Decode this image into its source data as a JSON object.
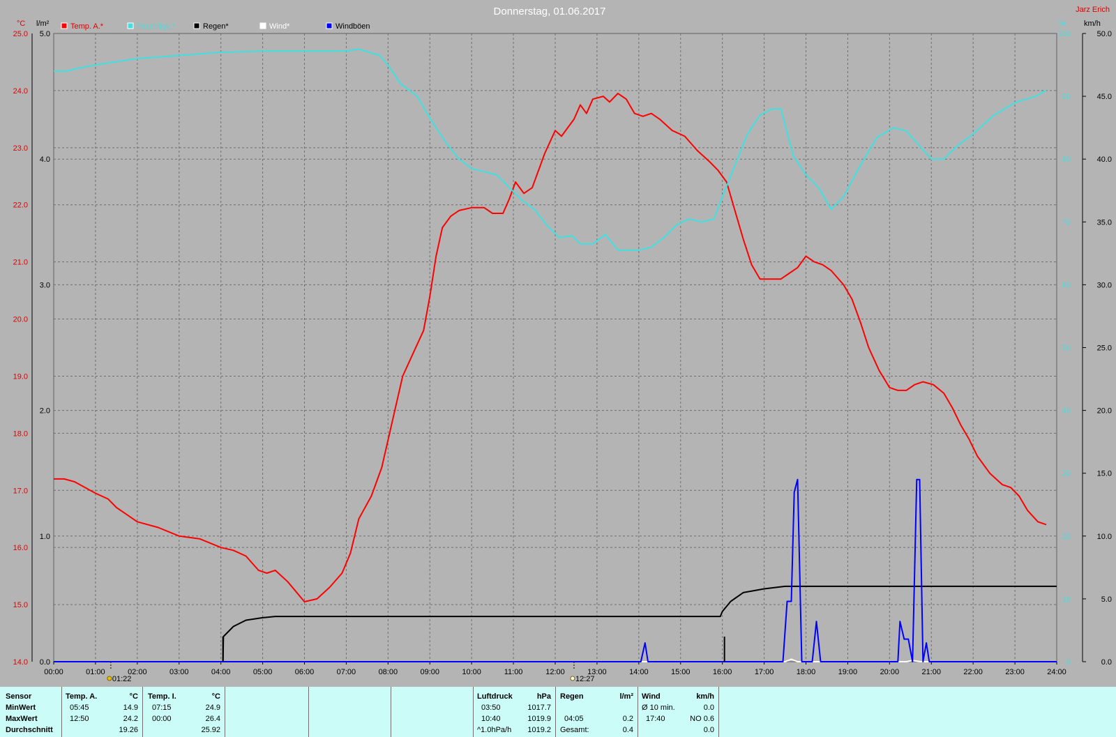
{
  "title": "Donnerstag, 01.06.2017",
  "station": "Jarz Erich",
  "axes": {
    "left_unit": "°C",
    "left_ticks": [
      "25.0",
      "24.0",
      "23.0",
      "22.0",
      "21.0",
      "20.0",
      "19.0",
      "18.0",
      "17.0",
      "16.0",
      "15.0",
      "14.0"
    ],
    "rain_unit": "l/m²",
    "rain_ticks": [
      "5.0",
      "4.0",
      "3.0",
      "2.0",
      "1.0",
      "0.0"
    ],
    "humidity_unit": "%",
    "humidity_ticks": [
      "100",
      "90",
      "80",
      "70",
      "60",
      "50",
      "40",
      "30",
      "20",
      "10",
      "0"
    ],
    "wind_unit": "km/h",
    "wind_ticks": [
      "50.0",
      "45.0",
      "40.0",
      "35.0",
      "30.0",
      "25.0",
      "20.0",
      "15.0",
      "10.0",
      "5.0",
      "0.0"
    ],
    "x_ticks": [
      "00:00",
      "01:00",
      "02:00",
      "03:00",
      "04:00",
      "05:00",
      "06:00",
      "07:00",
      "08:00",
      "09:00",
      "10:00",
      "11:00",
      "12:00",
      "13:00",
      "14:00",
      "15:00",
      "16:00",
      "17:00",
      "18:00",
      "19:00",
      "20:00",
      "21:00",
      "22:00",
      "23:00",
      "24:00"
    ]
  },
  "sun": {
    "sunrise": "01:22",
    "sunset": "12:27"
  },
  "legend": [
    {
      "label": "Temp. A.*",
      "color": "#ff0000"
    },
    {
      "label": "Feuchtigk.*",
      "color": "#40e0e0"
    },
    {
      "label": "Regen*",
      "color": "#000000"
    },
    {
      "label": "Wind*",
      "color": "#ffffff"
    },
    {
      "label": "Windböen",
      "color": "#0000ff"
    }
  ],
  "chart_data": {
    "type": "line",
    "title": "Donnerstag, 01.06.2017",
    "x_unit": "hours",
    "xlim": [
      0,
      24
    ],
    "grid": true,
    "legend_position": "top-left",
    "series": [
      {
        "name": "Temp. A.*",
        "axis": "°C",
        "ylim": [
          14,
          25
        ],
        "color": "#ff0000",
        "points": [
          [
            0,
            17.2
          ],
          [
            0.25,
            17.2
          ],
          [
            0.5,
            17.15
          ],
          [
            1,
            16.95
          ],
          [
            1.3,
            16.85
          ],
          [
            1.5,
            16.7
          ],
          [
            1.8,
            16.55
          ],
          [
            2,
            16.45
          ],
          [
            2.5,
            16.35
          ],
          [
            3,
            16.2
          ],
          [
            3.5,
            16.15
          ],
          [
            4,
            16.0
          ],
          [
            4.3,
            15.95
          ],
          [
            4.6,
            15.85
          ],
          [
            4.9,
            15.6
          ],
          [
            5.1,
            15.55
          ],
          [
            5.3,
            15.6
          ],
          [
            5.6,
            15.4
          ],
          [
            6,
            15.05
          ],
          [
            6.3,
            15.1
          ],
          [
            6.6,
            15.3
          ],
          [
            6.9,
            15.55
          ],
          [
            7.1,
            15.9
          ],
          [
            7.3,
            16.5
          ],
          [
            7.6,
            16.9
          ],
          [
            7.85,
            17.4
          ],
          [
            8.1,
            18.2
          ],
          [
            8.35,
            19.0
          ],
          [
            8.6,
            19.4
          ],
          [
            8.85,
            19.8
          ],
          [
            9.0,
            20.4
          ],
          [
            9.15,
            21.1
          ],
          [
            9.3,
            21.6
          ],
          [
            9.5,
            21.8
          ],
          [
            9.7,
            21.9
          ],
          [
            10.0,
            21.95
          ],
          [
            10.3,
            21.95
          ],
          [
            10.5,
            21.85
          ],
          [
            10.75,
            21.85
          ],
          [
            10.9,
            22.1
          ],
          [
            11.05,
            22.4
          ],
          [
            11.25,
            22.2
          ],
          [
            11.45,
            22.3
          ],
          [
            11.6,
            22.6
          ],
          [
            11.75,
            22.9
          ],
          [
            12.0,
            23.3
          ],
          [
            12.15,
            23.2
          ],
          [
            12.3,
            23.35
          ],
          [
            12.45,
            23.5
          ],
          [
            12.6,
            23.75
          ],
          [
            12.75,
            23.6
          ],
          [
            12.9,
            23.85
          ],
          [
            13.15,
            23.9
          ],
          [
            13.3,
            23.8
          ],
          [
            13.5,
            23.95
          ],
          [
            13.7,
            23.85
          ],
          [
            13.9,
            23.6
          ],
          [
            14.1,
            23.55
          ],
          [
            14.3,
            23.6
          ],
          [
            14.5,
            23.5
          ],
          [
            14.8,
            23.3
          ],
          [
            15.1,
            23.2
          ],
          [
            15.4,
            22.95
          ],
          [
            15.7,
            22.75
          ],
          [
            15.9,
            22.6
          ],
          [
            16.1,
            22.4
          ],
          [
            16.3,
            21.9
          ],
          [
            16.5,
            21.4
          ],
          [
            16.7,
            20.95
          ],
          [
            16.9,
            20.7
          ],
          [
            17.2,
            20.7
          ],
          [
            17.4,
            20.7
          ],
          [
            17.6,
            20.8
          ],
          [
            17.8,
            20.9
          ],
          [
            18.0,
            21.1
          ],
          [
            18.2,
            21.0
          ],
          [
            18.4,
            20.95
          ],
          [
            18.6,
            20.85
          ],
          [
            18.9,
            20.6
          ],
          [
            19.1,
            20.35
          ],
          [
            19.3,
            19.95
          ],
          [
            19.5,
            19.5
          ],
          [
            19.75,
            19.1
          ],
          [
            20.0,
            18.8
          ],
          [
            20.2,
            18.75
          ],
          [
            20.4,
            18.75
          ],
          [
            20.6,
            18.85
          ],
          [
            20.8,
            18.9
          ],
          [
            21.05,
            18.85
          ],
          [
            21.3,
            18.7
          ],
          [
            21.5,
            18.45
          ],
          [
            21.7,
            18.15
          ],
          [
            21.9,
            17.9
          ],
          [
            22.1,
            17.6
          ],
          [
            22.4,
            17.3
          ],
          [
            22.7,
            17.1
          ],
          [
            22.9,
            17.05
          ],
          [
            23.1,
            16.9
          ],
          [
            23.3,
            16.65
          ],
          [
            23.55,
            16.45
          ],
          [
            23.75,
            16.4
          ]
        ]
      },
      {
        "name": "Feuchtigk.*",
        "axis": "%",
        "ylim": [
          0,
          100
        ],
        "color": "#40e0e0",
        "points": [
          [
            0,
            94
          ],
          [
            0.3,
            94
          ],
          [
            0.6,
            94.5
          ],
          [
            1,
            95
          ],
          [
            1.5,
            95.5
          ],
          [
            2,
            96
          ],
          [
            3,
            96.5
          ],
          [
            4,
            97
          ],
          [
            5,
            97.2
          ],
          [
            6,
            97.2
          ],
          [
            7,
            97.2
          ],
          [
            7.3,
            97.5
          ],
          [
            7.8,
            96.5
          ],
          [
            8.0,
            95
          ],
          [
            8.3,
            92
          ],
          [
            8.7,
            90
          ],
          [
            9.0,
            86.5
          ],
          [
            9.4,
            82.5
          ],
          [
            9.7,
            80
          ],
          [
            10.0,
            78.5
          ],
          [
            10.3,
            78
          ],
          [
            10.6,
            77.5
          ],
          [
            10.9,
            75.5
          ],
          [
            11.2,
            73.5
          ],
          [
            11.5,
            72
          ],
          [
            11.8,
            69.5
          ],
          [
            12.1,
            67.5
          ],
          [
            12.4,
            67.8
          ],
          [
            12.6,
            66.5
          ],
          [
            12.9,
            66.5
          ],
          [
            13.2,
            68
          ],
          [
            13.5,
            65.5
          ],
          [
            13.8,
            65.5
          ],
          [
            14.0,
            65.5
          ],
          [
            14.3,
            66
          ],
          [
            14.6,
            67.5
          ],
          [
            14.9,
            69.5
          ],
          [
            15.2,
            70.5
          ],
          [
            15.5,
            70
          ],
          [
            15.8,
            70.5
          ],
          [
            16.0,
            74
          ],
          [
            16.3,
            79
          ],
          [
            16.6,
            84
          ],
          [
            16.9,
            87
          ],
          [
            17.2,
            88
          ],
          [
            17.4,
            88
          ],
          [
            17.7,
            80.5
          ],
          [
            18.0,
            77.5
          ],
          [
            18.3,
            75.5
          ],
          [
            18.6,
            72
          ],
          [
            18.9,
            74
          ],
          [
            19.3,
            79
          ],
          [
            19.7,
            83.5
          ],
          [
            20.1,
            85
          ],
          [
            20.4,
            84.5
          ],
          [
            20.8,
            81.5
          ],
          [
            21.0,
            80
          ],
          [
            21.3,
            80
          ],
          [
            21.6,
            82
          ],
          [
            22.0,
            84
          ],
          [
            22.5,
            87
          ],
          [
            23.0,
            89
          ],
          [
            23.5,
            90
          ],
          [
            23.75,
            91
          ]
        ]
      },
      {
        "name": "Regen*",
        "axis": "l/m²",
        "ylim": [
          0,
          5
        ],
        "color": "#000000",
        "points": [
          [
            0,
            0
          ],
          [
            4.05,
            0
          ],
          [
            4.06,
            0.2
          ],
          [
            4.3,
            0.28
          ],
          [
            4.6,
            0.33
          ],
          [
            5.0,
            0.35
          ],
          [
            5.3,
            0.36
          ],
          [
            6,
            0.36
          ],
          [
            10,
            0.36
          ],
          [
            15.95,
            0.36
          ],
          [
            16.0,
            0.4
          ],
          [
            16.2,
            0.48
          ],
          [
            16.5,
            0.55
          ],
          [
            17.0,
            0.58
          ],
          [
            17.5,
            0.6
          ],
          [
            24,
            0.6
          ]
        ]
      },
      {
        "name": "Wind*",
        "axis": "km/h",
        "ylim": [
          0,
          50
        ],
        "color": "#ffffff",
        "points": [
          [
            0,
            0
          ],
          [
            17.5,
            0
          ],
          [
            17.65,
            0.2
          ],
          [
            17.8,
            0
          ],
          [
            20.4,
            0
          ],
          [
            20.55,
            0.1
          ],
          [
            20.75,
            0
          ],
          [
            24,
            0
          ]
        ]
      },
      {
        "name": "Windböen",
        "axis": "km/h",
        "ylim": [
          0,
          50
        ],
        "color": "#0000ff",
        "points": [
          [
            0,
            0
          ],
          [
            14.05,
            0
          ],
          [
            14.15,
            1.5
          ],
          [
            14.22,
            0
          ],
          [
            17.45,
            0
          ],
          [
            17.55,
            4.8
          ],
          [
            17.65,
            4.8
          ],
          [
            17.72,
            13.5
          ],
          [
            17.8,
            14.5
          ],
          [
            17.9,
            0
          ],
          [
            18.15,
            0
          ],
          [
            18.25,
            3.2
          ],
          [
            18.35,
            0
          ],
          [
            20.2,
            0
          ],
          [
            20.25,
            3.2
          ],
          [
            20.35,
            1.8
          ],
          [
            20.45,
            1.8
          ],
          [
            20.55,
            0
          ],
          [
            20.65,
            14.5
          ],
          [
            20.72,
            14.5
          ],
          [
            20.8,
            0
          ],
          [
            20.88,
            1.5
          ],
          [
            20.95,
            0
          ],
          [
            24,
            0
          ]
        ]
      }
    ]
  },
  "stats": {
    "sensor": {
      "header": "Sensor",
      "min_label": "MinWert",
      "max_label": "MaxWert",
      "avg_label": "Durchschnitt"
    },
    "temp_a": {
      "header": "Temp. A.",
      "unit": "°C",
      "min_time": "05:45",
      "min_value": "14.9",
      "max_time": "12:50",
      "max_value": "24.2",
      "avg_value": "19.26"
    },
    "temp_i": {
      "header": "Temp. I.",
      "unit": "°C",
      "min_time": "07:15",
      "min_value": "24.9",
      "max_time": "00:00",
      "max_value": "26.4",
      "avg_value": "25.92"
    },
    "pressure": {
      "header": "Luftdruck",
      "unit": "hPa",
      "min_time": "03:50",
      "min_value": "1017.7",
      "max_time": "10:40",
      "max_value": "1019.9",
      "trend_label": "^1.0hPa/h",
      "trend_value": "1019.2"
    },
    "rain": {
      "header": "Regen",
      "unit": "l/m²",
      "max_time": "04:05",
      "max_value": "0.2",
      "total_label": "Gesamt:",
      "total_value": "0.4"
    },
    "wind": {
      "header": "Wind",
      "unit": "km/h",
      "avg_label": "Ø 10 min.",
      "avg_value": "0.0",
      "max_time": "17:40",
      "max_dir": "NO 0.6",
      "last_value": "0.0"
    }
  }
}
